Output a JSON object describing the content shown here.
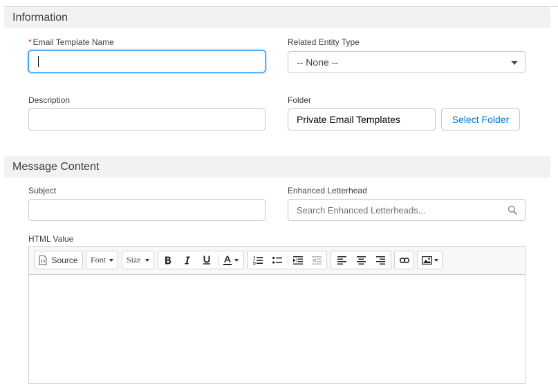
{
  "sections": {
    "information": "Information",
    "message_content": "Message Content"
  },
  "fields": {
    "required_mark": "*",
    "email_template_name": {
      "label": "Email Template Name",
      "value": ""
    },
    "related_entity_type": {
      "label": "Related Entity Type",
      "value": "-- None --"
    },
    "description": {
      "label": "Description",
      "value": ""
    },
    "folder": {
      "label": "Folder",
      "value": "Private Email Templates",
      "button": "Select Folder"
    },
    "subject": {
      "label": "Subject",
      "value": ""
    },
    "enhanced_letterhead": {
      "label": "Enhanced Letterhead",
      "placeholder": "Search Enhanced Letterheads..."
    },
    "html_value": {
      "label": "HTML Value"
    }
  },
  "toolbar": {
    "source": "Source",
    "font": "Font",
    "size": "Size",
    "icons": [
      "source-icon",
      "bold-icon",
      "italic-icon",
      "underline-icon",
      "text-color-icon",
      "numbered-list-icon",
      "bulleted-list-icon",
      "indent-icon",
      "outdent-icon",
      "align-left-icon",
      "align-center-icon",
      "align-right-icon",
      "link-icon",
      "image-icon"
    ]
  },
  "colors": {
    "focus": "#1b96ff",
    "link": "#0176d3",
    "required": "#c23934",
    "section_bg": "#f3f2f2"
  }
}
